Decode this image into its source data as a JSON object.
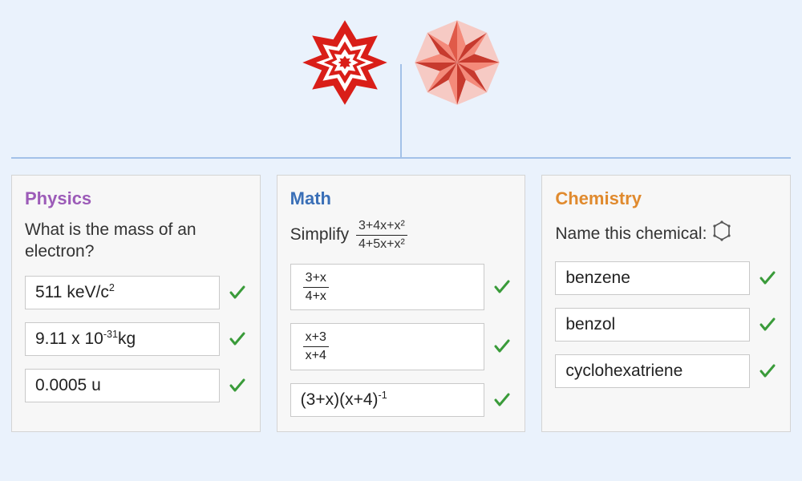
{
  "logos": [
    "mathematica",
    "wolfram-alpha"
  ],
  "cards": [
    {
      "id": "physics",
      "title": "Physics",
      "question": "What is the mass of an electron?",
      "answers": [
        {
          "display": "511 keV/c²",
          "html": "511 keV/c<sup>2</sup>",
          "correct": true
        },
        {
          "display": "9.11 x 10⁻³¹ kg",
          "html": "9.11 x 10<sup>-31</sup>kg",
          "correct": true
        },
        {
          "display": "0.0005 u",
          "html": "0.0005 u",
          "correct": true
        }
      ]
    },
    {
      "id": "math",
      "title": "Math",
      "question_prefix": "Simplify",
      "question_fraction": {
        "num": "3+4x+x²",
        "den": "4+5x+x²"
      },
      "answers": [
        {
          "type": "fraction",
          "num": "3+x",
          "den": "4+x",
          "display": "(3+x)/(4+x)",
          "correct": true
        },
        {
          "type": "fraction",
          "num": "x+3",
          "den": "x+4",
          "display": "(x+3)/(x+4)",
          "correct": true
        },
        {
          "display": "(3+x)(x+4)⁻¹",
          "html": "(3+x)(x+4)<sup>-1</sup>",
          "correct": true
        }
      ]
    },
    {
      "id": "chemistry",
      "title": "Chemistry",
      "question": "Name this chemical:",
      "has_molecule_icon": true,
      "answers": [
        {
          "display": "benzene",
          "correct": true
        },
        {
          "display": "benzol",
          "correct": true
        },
        {
          "display": "cyclohexatriene",
          "correct": true
        }
      ]
    }
  ]
}
